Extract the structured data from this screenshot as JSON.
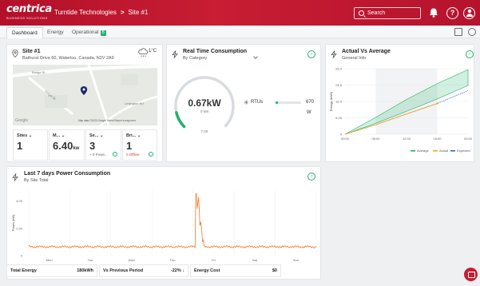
{
  "header": {
    "logo_word": "centrica",
    "logo_sub": "BUSINESS SOLUTIONS",
    "org": "Turntide Technologies",
    "separator": ">",
    "site": "Site #1",
    "search_placeholder": "Search"
  },
  "tabs": [
    {
      "label": "Dashboard",
      "active": true
    },
    {
      "label": "Energy",
      "active": false
    },
    {
      "label": "Operational",
      "active": false,
      "badge": "B"
    }
  ],
  "site_card": {
    "title": "Site #1",
    "address": "Bathurst Drive 60, Waterloo, Canada, N2V 2A9",
    "weather_temp": "1°C",
    "weather_icon": "cloud-snow-icon",
    "map_logo": "Google",
    "map_attribution": "Map data ©2023 Google  Terms  Report a map error",
    "map_streets": [
      "Bridge St",
      "Kingst St",
      "Lexington Rd"
    ],
    "kpis": [
      {
        "label": "Sites",
        "value": "1",
        "unit": "",
        "note": ""
      },
      {
        "label": "M...",
        "value": "6.40",
        "unit": "kw",
        "note": ""
      },
      {
        "label": "Se...",
        "value": "3",
        "unit": "",
        "note": "+ 0 Powe..."
      },
      {
        "label": "Bri...",
        "value": "1",
        "unit": "",
        "note": "0 Offline"
      }
    ]
  },
  "consumption_card": {
    "title": "Real Time Consumption",
    "subtitle": "By Category",
    "gauge_value": "0.67kW",
    "gauge_sub": "0 kW",
    "gauge_max": "7.00",
    "gauge_fraction": 0.12,
    "rtu_label": "RTUs",
    "rtu_value": "670",
    "rtu_unit": "W",
    "rtu_fraction": 0.1
  },
  "actual_card": {
    "title": "Actual Vs Average",
    "subtitle": "General Info"
  },
  "power_card": {
    "title": "Last 7 days Power Consumption",
    "subtitle": "By Site Total"
  },
  "summary": [
    {
      "label": "Total Energy",
      "value": "180kWh"
    },
    {
      "label": "Vs Previous Period",
      "value": "-22% ↓"
    },
    {
      "label": "Energy Cost",
      "value": "$0"
    }
  ],
  "colors": {
    "brand": "#c81d33",
    "accent_green": "#20b26b",
    "average": "#20b26b",
    "actual": "#f5a623",
    "expected": "#3a66c4",
    "power_line": "#f07a2a"
  },
  "chart_data": [
    {
      "type": "area",
      "title": "Actual Vs Average",
      "ylabel": "Energy (kWh)",
      "x": [
        "00:00",
        "06:00",
        "12:00",
        "18:00",
        "00:00"
      ],
      "ylim": [
        0,
        33
      ],
      "yticks": [
        "0",
        "8.25",
        "16.5",
        "24.8",
        "33.0"
      ],
      "legend": "bottom-right",
      "series": [
        {
          "name": "Average",
          "values_low": [
            0,
            5.5,
            11.5,
            17.8,
            24.5
          ],
          "values_high": [
            0,
            8.5,
            17.5,
            25.5,
            32.5
          ]
        },
        {
          "name": "Actual",
          "values": [
            0,
            4.8,
            10.2,
            15.5
          ]
        },
        {
          "name": "Expected",
          "values": [
            0,
            4.8,
            10.2,
            15.5,
            22.0
          ]
        }
      ]
    },
    {
      "type": "line",
      "title": "Last 7 days Power Consumption",
      "ylabel": "Power (kW)",
      "xlabels": [
        "Mon",
        "Tue",
        "Wed",
        "Thu",
        "Fri",
        "Sat",
        "Sun"
      ],
      "ylim": [
        0,
        4.8
      ],
      "yticks": [
        "0",
        "2.00",
        "4.00"
      ],
      "base_value": 0.65,
      "spike": {
        "day_index": 4,
        "peak": 4.7,
        "duration_fraction": 0.2
      }
    }
  ]
}
